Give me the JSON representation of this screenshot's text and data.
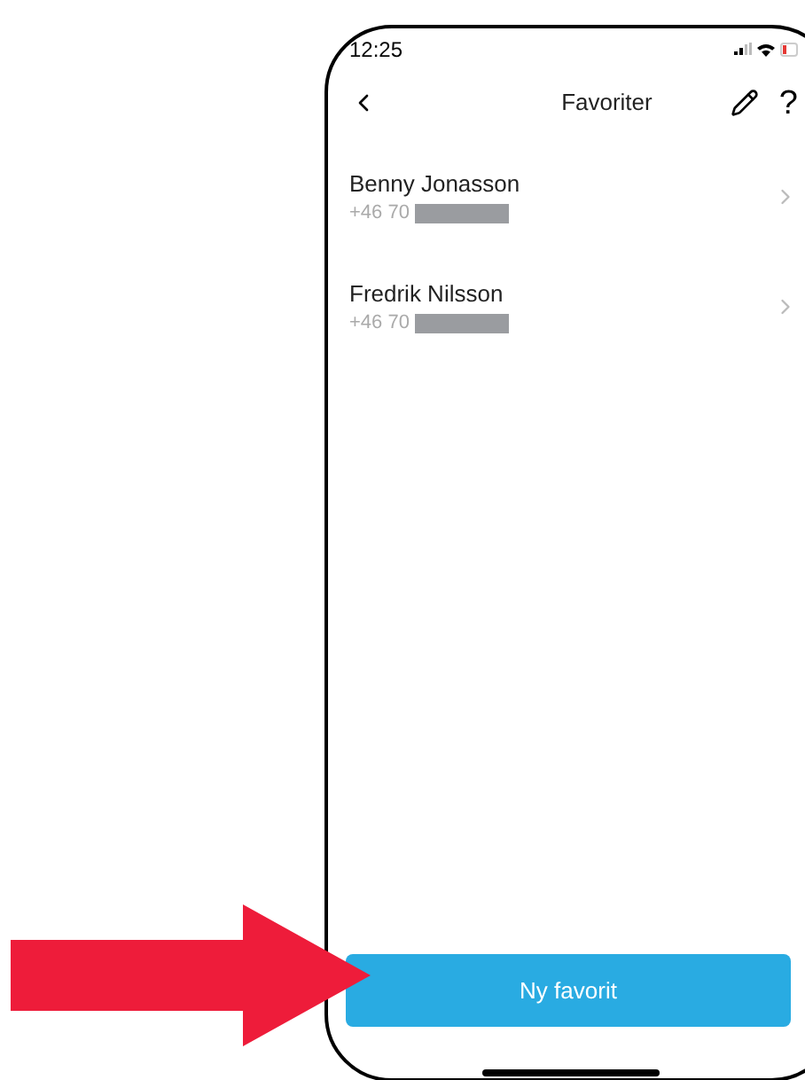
{
  "status_bar": {
    "time": "12:25"
  },
  "header": {
    "title": "Favoriter",
    "help": "?"
  },
  "favorites": [
    {
      "name": "Benny Jonasson",
      "phone": "+46 70"
    },
    {
      "name": "Fredrik Nilsson",
      "phone": "+46 70"
    }
  ],
  "primary_button": {
    "label": "Ny favorit"
  }
}
